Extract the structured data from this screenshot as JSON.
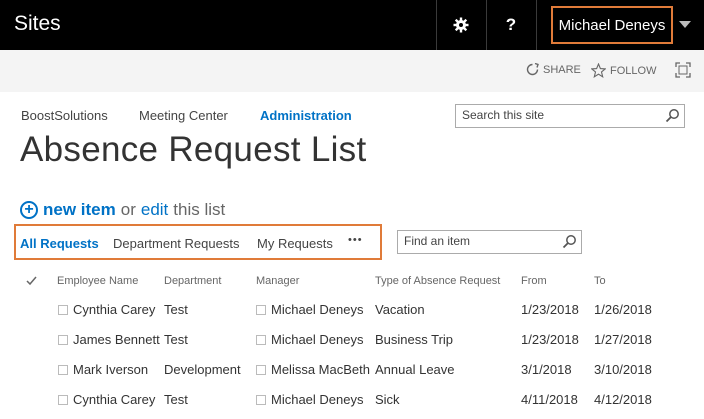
{
  "topbar": {
    "title": "Sites",
    "user": "Michael Deneys",
    "settings_icon": "gear-icon",
    "help_label": "?"
  },
  "actions": {
    "share": "SHARE",
    "follow": "FOLLOW"
  },
  "nav": {
    "items": [
      "BoostSolutions",
      "Meeting Center",
      "Administration"
    ],
    "active": "Administration"
  },
  "search": {
    "placeholder": "Search this site"
  },
  "page": {
    "title": "Absence Request List"
  },
  "commands": {
    "new_item": "new item",
    "or": "or",
    "edit": "edit",
    "this_list": "this list"
  },
  "views": {
    "items": [
      "All Requests",
      "Department Requests",
      "My Requests"
    ],
    "more": "•••",
    "active": "All Requests"
  },
  "find": {
    "placeholder": "Find an item"
  },
  "table": {
    "headers": [
      "Employee Name",
      "Department",
      "Manager",
      "Type of Absence Request",
      "From",
      "To"
    ],
    "rows": [
      [
        "Cynthia Carey",
        "Test",
        "Michael Deneys",
        "Vacation",
        "1/23/2018",
        "1/26/2018"
      ],
      [
        "James Bennett",
        "Test",
        "Michael Deneys",
        "Business Trip",
        "1/23/2018",
        "1/27/2018"
      ],
      [
        "Mark Iverson",
        "Development",
        "Melissa MacBeth",
        "Annual Leave",
        "3/1/2018",
        "3/10/2018"
      ],
      [
        "Cynthia Carey",
        "Test",
        "Michael Deneys",
        "Sick",
        "4/11/2018",
        "4/12/2018"
      ]
    ]
  },
  "colors": {
    "accent": "#0072c6",
    "highlight": "#e07b39",
    "topbar": "#000000"
  }
}
